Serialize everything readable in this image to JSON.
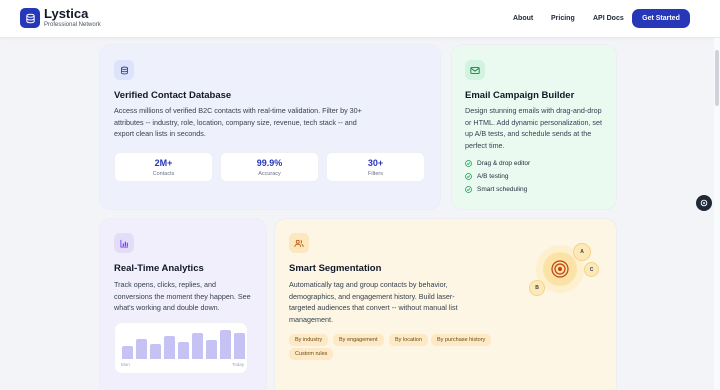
{
  "nav": {
    "brand": "Lystica",
    "tagline": "Professional Network",
    "links": [
      "About",
      "Pricing",
      "API Docs"
    ],
    "cta": "Get Started"
  },
  "cards": {
    "database": {
      "title": "Verified Contact Database",
      "text": "Access millions of verified B2C contacts with real-time validation. Filter by 30+ attributes -- industry, role, location, company size, revenue, tech stack -- and export clean lists in seconds.",
      "stats": [
        {
          "value": "2M+",
          "label": "Contacts"
        },
        {
          "value": "99.9%",
          "label": "Accuracy"
        },
        {
          "value": "30+",
          "label": "Filters"
        }
      ]
    },
    "email": {
      "title": "Email Campaign Builder",
      "text": "Design stunning emails with drag-and-drop or HTML. Add dynamic personalization, set up A/B tests, and schedule sends at the perfect time.",
      "features": [
        "Drag & drop editor",
        "A/B testing",
        "Smart scheduling"
      ]
    },
    "analytics": {
      "title": "Real-Time Analytics",
      "text": "Track opens, clicks, replies, and conversions the moment they happen. See what's working and double down.",
      "chart": {
        "start_label": "Mon",
        "end_label": "Today",
        "bar_levels": [
          0.42,
          0.65,
          0.5,
          0.78,
          0.58,
          0.86,
          0.62,
          0.98,
          0.87
        ]
      }
    },
    "segmentation": {
      "title": "Smart Segmentation",
      "text": "Automatically tag and group contacts by behavior, demographics, and engagement history. Build laser-targeted audiences that convert -- without manual list management.",
      "tags": [
        "By industry",
        "By engagement",
        "By location",
        "By purchase history",
        "Custom rules"
      ],
      "nodes": [
        "A",
        "B",
        "C"
      ]
    }
  },
  "colors": {
    "brand": "#2637b8",
    "database_bg": "#eef0fb",
    "email_bg": "#eafaf1",
    "analytics_bg": "#f1effc",
    "segmentation_bg": "#fdf6e4",
    "chart_bar": "#c6c2f4",
    "tag_bg": "#fde9c6"
  }
}
